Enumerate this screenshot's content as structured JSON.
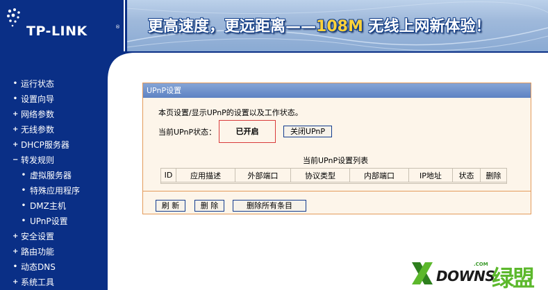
{
  "header": {
    "logo_text": "TP-LINK",
    "logo_mark": "®",
    "banner_part1": "更高速度，更远距离——",
    "banner_speed": "108M",
    "banner_part2": " 无线上网新体验！"
  },
  "sidebar": {
    "items": [
      {
        "bullet": "•",
        "label": "运行状态"
      },
      {
        "bullet": "•",
        "label": "设置向导"
      },
      {
        "bullet": "+",
        "label": "网络参数"
      },
      {
        "bullet": "+",
        "label": "无线参数"
      },
      {
        "bullet": "+",
        "label": "DHCP服务器"
      },
      {
        "bullet": "−",
        "label": "转发规则"
      },
      {
        "bullet": "•",
        "label": "虚拟服务器"
      },
      {
        "bullet": "•",
        "label": "特殊应用程序"
      },
      {
        "bullet": "•",
        "label": "DMZ主机"
      },
      {
        "bullet": "•",
        "label": "UPnP设置"
      },
      {
        "bullet": "+",
        "label": "安全设置"
      },
      {
        "bullet": "+",
        "label": "路由功能"
      },
      {
        "bullet": "•",
        "label": "动态DNS"
      },
      {
        "bullet": "+",
        "label": "系统工具"
      }
    ]
  },
  "panel": {
    "title": "UPnP设置",
    "intro": "本页设置/显示UPnP的设置以及工作状态。",
    "status_label": "当前UPnP状态：",
    "status_value": "已开启",
    "close_button": "关闭UPnP",
    "table_caption": "当前UPnP设置列表",
    "table_headers": [
      "ID",
      "应用描述",
      "外部端口",
      "协议类型",
      "内部端口",
      "IP地址",
      "状态",
      "删除"
    ],
    "refresh_button": "刷 新",
    "delete_button": "删 除",
    "delete_all_button": "删除所有条目"
  },
  "watermark": {
    "brand": "DOWNS",
    "domain_suffix": ".COM",
    "cn_name": "绿盟"
  },
  "colors": {
    "navy": "#0a2f86",
    "panel_border": "#e39a5a",
    "panel_bg": "#fdf5ea",
    "title_bar": "#5d82c3",
    "status_highlight": "#d93a3a",
    "watermark_green": "#5cb82c"
  }
}
